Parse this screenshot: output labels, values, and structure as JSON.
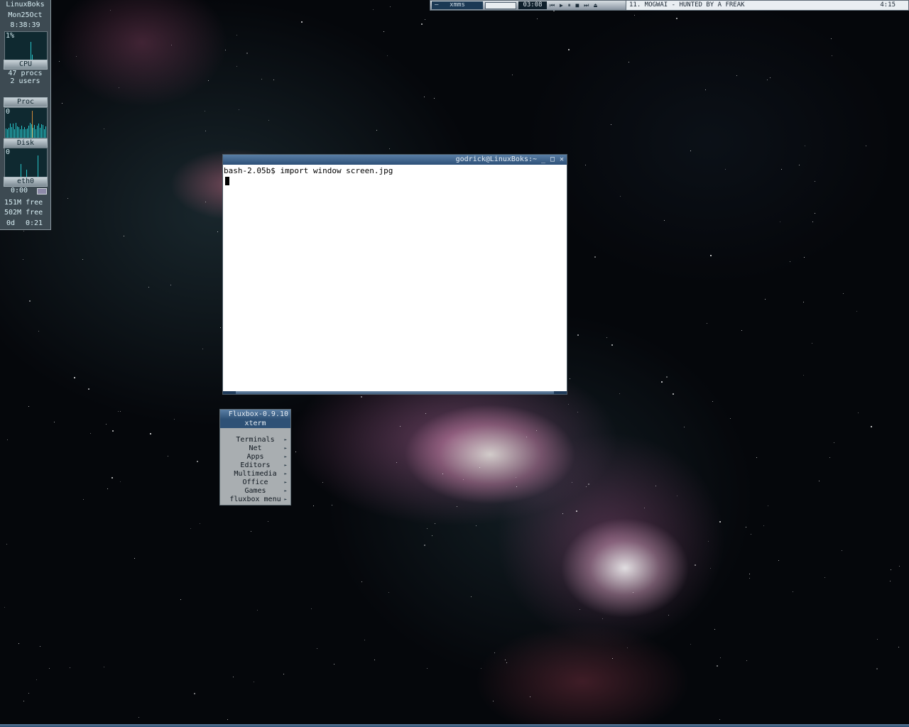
{
  "gkrellm": {
    "hostname": "LinuxBoks",
    "date": "Mon25Oct",
    "time": "8:38:39",
    "cpu_percent": "1%",
    "cpu_label": "CPU",
    "procs": "47 procs",
    "users": "2 users",
    "proc_label": "Proc",
    "proc_value": "0",
    "disk_label": "Disk",
    "disk_value": "0",
    "net_label": "eth0",
    "net_timer": "0:00",
    "mem_free": "151M free",
    "swap_free": "502M free",
    "uptime_days": "0d",
    "uptime_time": "0:21"
  },
  "xmms": {
    "dash": "—",
    "title": "xmms",
    "time": "03:08",
    "controls": "⏮ ▶ ⏸ ■ ⏭ ⏏",
    "song": "11. MOGWAI - HUNTED BY A FREAK",
    "duration": "4:15"
  },
  "xterm": {
    "title": "godrick@LinuxBoks:~",
    "minimize": "_",
    "maximize": "□",
    "close": "✕",
    "prompt_line": "bash-2.05b$ import window screen.jpg"
  },
  "fluxbox_menu": {
    "title": "Fluxbox-0.9.10",
    "selected": "xterm",
    "items": [
      {
        "label": "Terminals"
      },
      {
        "label": "Net"
      },
      {
        "label": "Apps"
      },
      {
        "label": "Editors"
      },
      {
        "label": "Multimedia"
      },
      {
        "label": "Office"
      },
      {
        "label": "Games"
      },
      {
        "label": "fluxbox menu"
      }
    ],
    "submenu_arrow": "►"
  },
  "colors": {
    "accent_blue": "#2f5277",
    "panel_bg": "#3d4a52",
    "graph_line": "#27c4c9"
  }
}
